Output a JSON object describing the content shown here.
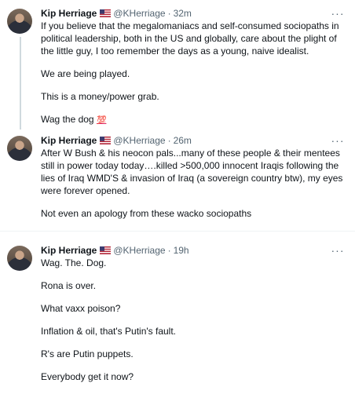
{
  "tweets": [
    {
      "name": "Kip Herriage",
      "flag": "flag-us-icon",
      "handle": "@KHerriage",
      "sep": "·",
      "time": "32m",
      "more": "···",
      "paragraphs": [
        "If you believe that the megalomaniacs and self-consumed sociopaths in political leadership, both in the US and globally, care about the plight of the little guy, I too remember the days as a young, naive idealist.",
        "We are being played.",
        "This is a money/power grab."
      ],
      "last_text": "Wag the dog",
      "last_emoji": "💯"
    },
    {
      "name": "Kip Herriage",
      "flag": "flag-us-icon",
      "handle": "@KHerriage",
      "sep": "·",
      "time": "26m",
      "more": "···",
      "paragraphs": [
        "After W Bush & his neocon pals...many of these people & their mentees still in power today today….killed >500,000 innocent Iraqis following the lies of Iraq WMD'S & invasion of Iraq (a sovereign country btw), my eyes were forever opened.",
        "Not even an apology from these wacko sociopaths"
      ]
    },
    {
      "name": "Kip Herriage",
      "flag": "flag-us-icon",
      "handle": "@KHerriage",
      "sep": "·",
      "time": "19h",
      "more": "···",
      "paragraphs": [
        "Wag. The. Dog.",
        "Rona is over.",
        "What vaxx poison?",
        "Inflation & oil, that's Putin's fault.",
        "R's are Putin puppets.",
        "Everybody get it now?"
      ]
    }
  ]
}
